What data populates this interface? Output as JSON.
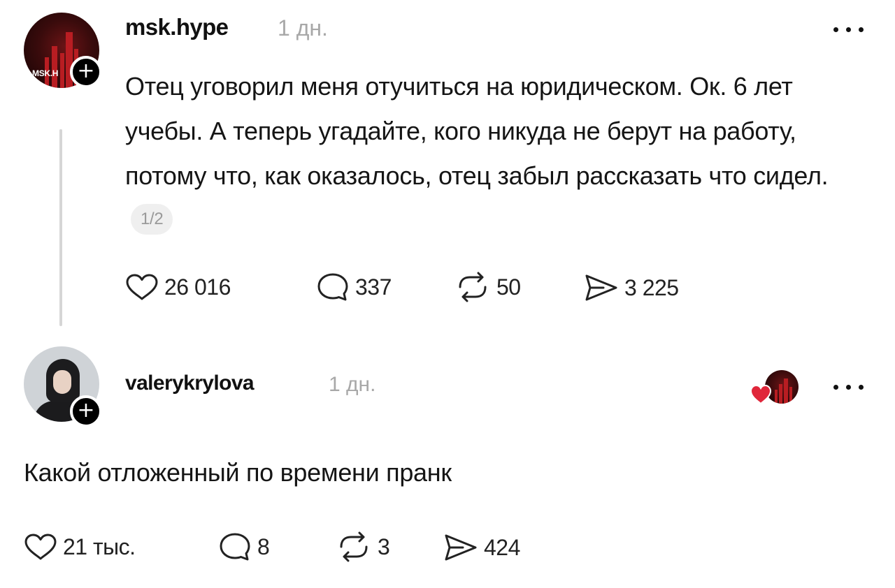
{
  "post": {
    "username": "msk.hype",
    "time": "1 дн.",
    "avatar_label": "MSK.H",
    "text": "Отец уговорил меня отучиться на юридическом. Ок. 6 лет учебы. А теперь угадайте, кого никуда не берут на работу, потому что, как оказалось, отец забыл рассказать что сидел.",
    "page_counter": "1/2",
    "likes": "26 016",
    "comments": "337",
    "reposts": "50",
    "shares": "3 225"
  },
  "reply": {
    "username": "valerykrylova",
    "time": "1 дн.",
    "text": "Какой отложенный по времени пранк",
    "likes": "21 тыс.",
    "comments": "8",
    "reposts": "3",
    "shares": "424"
  },
  "icons": {
    "like": "heart-outline-icon",
    "comment": "speech-bubble-icon",
    "repost": "repost-arrows-icon",
    "share": "send-arrow-icon",
    "more": "more-dots-icon",
    "follow": "plus-icon",
    "liked_by_author": "red-heart-icon"
  },
  "colors": {
    "text": "#151515",
    "muted": "#a8a8a8",
    "heart_red": "#e0263a",
    "avatar_red": "#b81d22"
  }
}
